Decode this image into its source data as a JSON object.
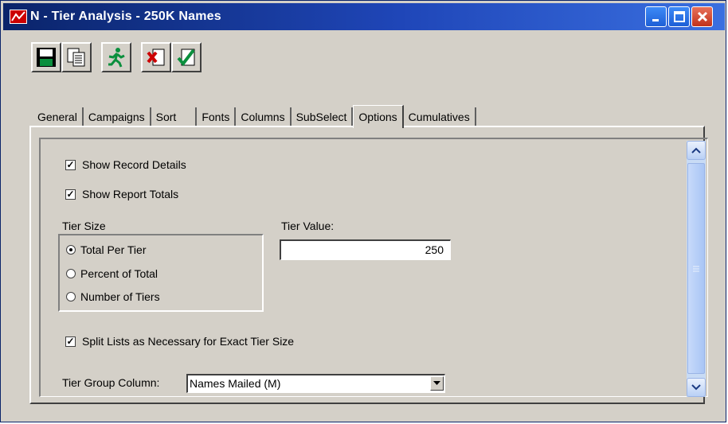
{
  "window": {
    "title": "N - Tier Analysis - 250K Names"
  },
  "toolbar": {
    "buttons": [
      {
        "icon": "save-icon"
      },
      {
        "icon": "copy-icon"
      },
      {
        "icon": "run-icon"
      },
      {
        "icon": "delete-icon"
      },
      {
        "icon": "ok-check-icon"
      }
    ]
  },
  "tabs": [
    "General",
    "Campaigns",
    "Sort",
    "Fonts",
    "Columns",
    "SubSelect",
    "Options",
    "Cumulatives"
  ],
  "active_tab": "Options",
  "options": {
    "show_record_details": {
      "label": "Show Record Details",
      "checked": true
    },
    "show_report_totals": {
      "label": "Show Report Totals",
      "checked": true
    },
    "tier_size": {
      "label": "Tier Size",
      "selected": "Total Per Tier",
      "choices": [
        "Total Per Tier",
        "Percent of Total",
        "Number of Tiers"
      ]
    },
    "tier_value": {
      "label": "Tier Value:",
      "value": "250"
    },
    "split_lists": {
      "label": "Split Lists as Necessary for Exact Tier Size",
      "checked": true
    },
    "tier_group_column": {
      "label": "Tier Group Column:",
      "value": "Names Mailed (M)"
    }
  },
  "colors": {
    "title_bar": "#0a246a",
    "face": "#d4d0c8",
    "close_button": "#c1321b"
  }
}
